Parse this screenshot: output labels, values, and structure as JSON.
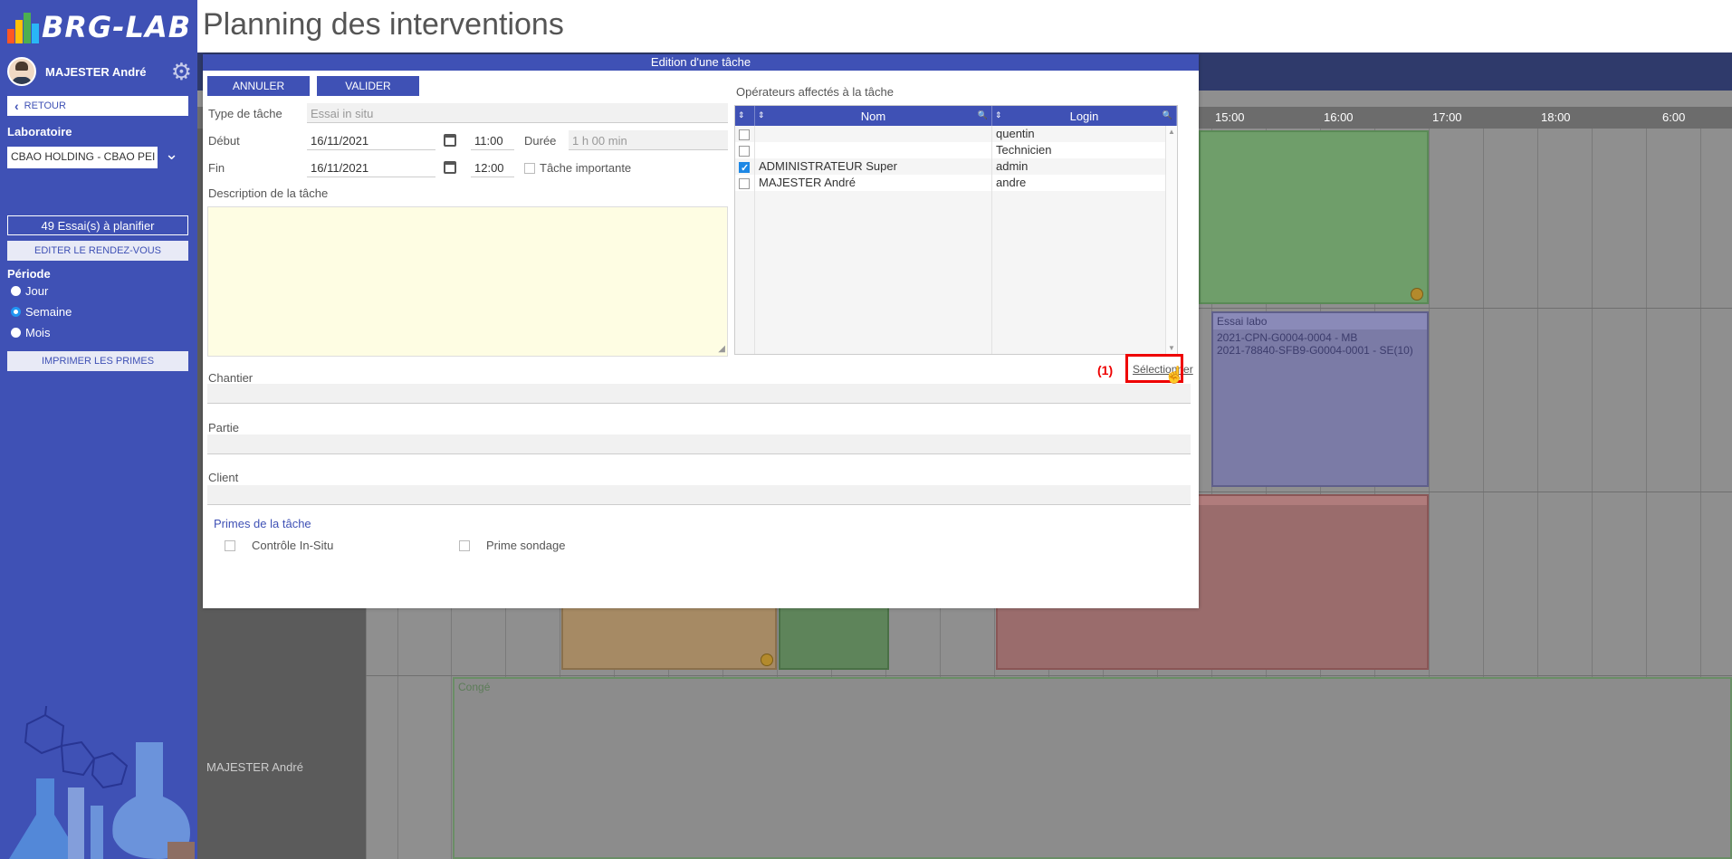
{
  "sidebar": {
    "logo_text": "BRG-LAB",
    "user_name": "MAJESTER André",
    "retour_label": "RETOUR",
    "laboratoire_label": "Laboratoire",
    "laboratoire_value": "CBAO HOLDING - CBAO PEI",
    "essais_label": "49 Essai(s) à planifier",
    "editer_label": "EDITER LE RENDEZ-VOUS",
    "periode_label": "Période",
    "periodes": [
      {
        "label": "Jour",
        "checked": false
      },
      {
        "label": "Semaine",
        "checked": true
      },
      {
        "label": "Mois",
        "checked": false
      }
    ],
    "imprimer_label": "IMPRIMER LES PRIMES"
  },
  "page": {
    "title": "Planning des interventions"
  },
  "planning": {
    "hours": [
      "15:00",
      "16:00",
      "17:00",
      "18:00",
      "6:00"
    ],
    "events": {
      "essai_labo": {
        "title": "Essai labo",
        "lines": [
          "2021-CPN-G0004-0004 - MB",
          "2021-78840-SFB9-G0004-0001 - SE(10)"
        ]
      },
      "conge": {
        "title": "Congé"
      }
    },
    "row_name": "MAJESTER André"
  },
  "dialog": {
    "title": "Edition d'une tâche",
    "annuler_label": "ANNULER",
    "valider_label": "VALIDER",
    "type_label": "Type de tâche",
    "type_value": "Essai in situ",
    "debut_label": "Début",
    "debut_date": "16/11/2021",
    "debut_time": "11:00",
    "duree_label": "Durée",
    "duree_value": "1 h 00 min",
    "fin_label": "Fin",
    "fin_date": "16/11/2021",
    "fin_time": "12:00",
    "importante_label": "Tâche importante",
    "description_label": "Description de la tâche",
    "operateurs_label": "Opérateurs affectés à la tâche",
    "grid_headers": {
      "nom": "Nom",
      "login": "Login"
    },
    "operators": [
      {
        "nom": "",
        "login": "quentin",
        "checked": false
      },
      {
        "nom": "",
        "login": "Technicien",
        "checked": false
      },
      {
        "nom": "ADMINISTRATEUR Super",
        "login": "admin",
        "checked": true
      },
      {
        "nom": "MAJESTER André",
        "login": "andre",
        "checked": false
      }
    ],
    "selectionner_label": "Sélectionner",
    "annotation": "(1)",
    "chantier_label": "Chantier",
    "partie_label": "Partie",
    "client_label": "Client",
    "primes_label": "Primes de la tâche",
    "primes": [
      {
        "label": "Contrôle In-Situ",
        "checked": false
      },
      {
        "label": "Prime sondage",
        "checked": false
      }
    ]
  },
  "colors": {
    "brand": "#3f51b5",
    "annotation": "#e00000"
  }
}
